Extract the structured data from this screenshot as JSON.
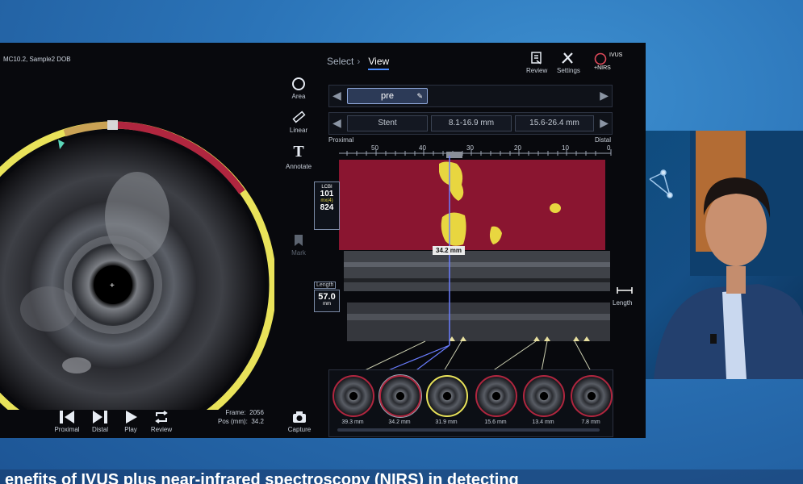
{
  "patient": {
    "text": "MC10.2, Sample2 DOB"
  },
  "nav": {
    "select": "Select",
    "view": "View"
  },
  "header": {
    "review": "Review",
    "settings": "Settings",
    "logo_top": "IVUS",
    "logo_bottom": "+NIRS"
  },
  "tools": {
    "area": "Area",
    "linear": "Linear",
    "annotate": "Annotate",
    "mark": "Mark"
  },
  "pullback": {
    "label": "pre"
  },
  "segments": [
    "Stent",
    "8.1-16.9 mm",
    "15.6-26.4 mm"
  ],
  "scale": {
    "proximal": "Proximal",
    "distal": "Distal",
    "ticks": [
      "50",
      "40",
      "30",
      "20",
      "10",
      "0"
    ]
  },
  "lcbi": {
    "title": "LCBI",
    "value": "101",
    "sub": "mx(4)",
    "sub_value": "824"
  },
  "length": {
    "title": "Length",
    "value": "57.0",
    "unit": "mm",
    "side_label": "Length"
  },
  "cursor": {
    "label": "34.2 mm"
  },
  "frame": {
    "frame_label": "Frame:",
    "frame_value": "2056",
    "pos_label": "Pos (mm):",
    "pos_value": "34.2"
  },
  "bottom_buttons": [
    "Proximal",
    "Distal",
    "Play",
    "Review"
  ],
  "capture": "Capture",
  "thumbnails": [
    "39.3 mm",
    "34.2 mm",
    "31.9 mm",
    "15.6 mm",
    "13.4 mm",
    "7.8 mm"
  ],
  "caption": "enefits of IVUS plus near-infrared spectroscopy (NIRS) in detecting",
  "colors": {
    "lipid_core": "#e8d640",
    "non_lipid": "#8a1530",
    "ring_yellow": "#e9e35a",
    "ring_red": "#b0263f",
    "accent": "#4a8cff"
  },
  "icons": [
    "area-icon",
    "linear-icon",
    "annotate-icon",
    "mark-icon",
    "review-icon",
    "settings-icon",
    "arrow-left-icon",
    "arrow-right-icon",
    "pencil-icon",
    "proximal-icon",
    "distal-icon",
    "play-icon",
    "loop-icon",
    "camera-icon"
  ]
}
